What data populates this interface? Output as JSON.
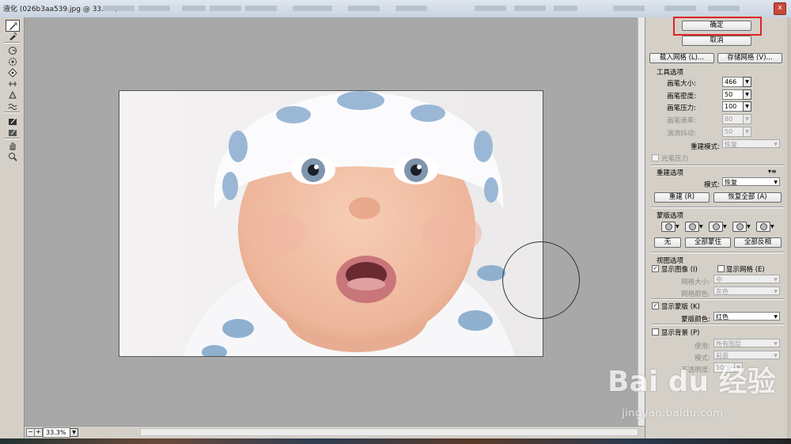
{
  "window": {
    "title": "液化 (026b3aa539.jpg @ 33.3%)",
    "close_glyph": "x"
  },
  "toolbox": {
    "tools": [
      {
        "icon": "forward-warp-icon",
        "selected": true
      },
      {
        "icon": "reconstruct-icon"
      },
      {
        "icon": "twirl-icon"
      },
      {
        "icon": "pucker-icon"
      },
      {
        "icon": "bloat-icon"
      },
      {
        "icon": "push-left-icon"
      },
      {
        "icon": "mirror-icon"
      },
      {
        "icon": "turbulence-icon"
      },
      {
        "icon": "freeze-mask-icon"
      },
      {
        "icon": "thaw-mask-icon"
      },
      {
        "icon": "hand-icon"
      },
      {
        "icon": "zoom-icon"
      }
    ]
  },
  "bottombar": {
    "zoom_out": "−",
    "zoom_in": "+",
    "zoom_value": "33.3%"
  },
  "panel": {
    "ok_label": "确定",
    "cancel_label": "取消",
    "load_mesh_label": "载入网格 (L)...",
    "save_mesh_label": "存储网格 (V)...",
    "tool_options": {
      "heading": "工具选项",
      "brush_size_label": "画笔大小:",
      "brush_size": "466",
      "brush_density_label": "画笔密度:",
      "brush_density": "50",
      "brush_pressure_label": "画笔压力:",
      "brush_pressure": "100",
      "brush_rate_label": "画笔速率:",
      "brush_rate": "80",
      "turbulent_jitter_label": "湍流抖动:",
      "turbulent_jitter": "50",
      "reconstruct_mode_label": "重建模式:",
      "reconstruct_mode": "恢复",
      "stylus_pressure_label": "光笔压力"
    },
    "reconstruct_options": {
      "heading": "重建选项",
      "mode_label": "模式:",
      "mode": "恢复",
      "reconstruct_label": "重建 (R)",
      "restore_all_label": "恢复全部 (A)"
    },
    "mask_options": {
      "heading": "蒙版选项",
      "none_label": "无",
      "mask_all_label": "全部蒙住",
      "invert_all_label": "全部反相"
    },
    "view_options": {
      "heading": "视图选项",
      "show_image_label": "显示图像 (I)",
      "show_mesh_label": "显示网格 (E)",
      "mesh_size_label": "网格大小:",
      "mesh_size": "中",
      "mesh_color_label": "网格颜色:",
      "mesh_color": "灰色",
      "show_mask_label": "显示蒙版 (K)",
      "mask_color_label": "蒙版颜色:",
      "mask_color": "红色",
      "show_backdrop_label": "显示背景 (P)",
      "use_label": "使用:",
      "use_value": "所有图层",
      "mode_label": "模式:",
      "mode_value": "前面",
      "opacity_label": "不透明度:",
      "opacity_value": "50"
    }
  },
  "watermark": {
    "logo": "Bai du 经验",
    "url": "jingyan.baidu.com"
  },
  "colors": {
    "highlight_box": "#e02323",
    "canvas_gray": "#a8a8a8",
    "panel_bg": "#d4d0c8"
  }
}
